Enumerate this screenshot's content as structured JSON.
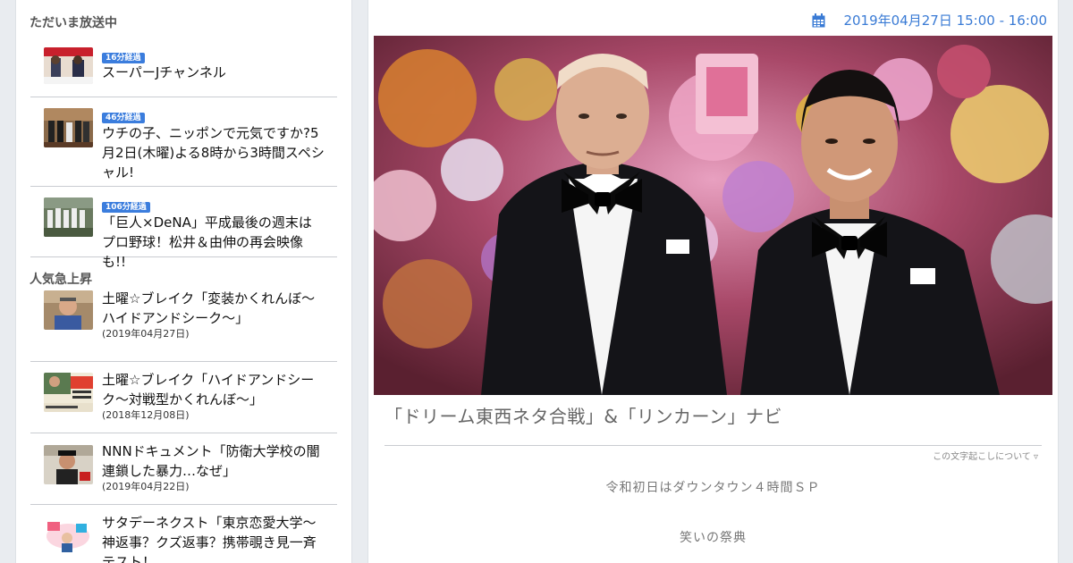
{
  "sidebar": {
    "on_air_title": "ただいま放送中",
    "on_air": [
      {
        "badge": "16分経過",
        "title": "スーパーJチャンネル"
      },
      {
        "badge": "46分経過",
        "title": "ウチの子、ニッポンで元気ですか?5月2日(木曜)よる8時から3時間スペシャル!"
      },
      {
        "badge": "106分経過",
        "title": "「巨人×DeNA」平成最後の週末はプロ野球！松井＆由伸の再会映像も!!"
      }
    ],
    "trending_title": "人気急上昇",
    "trending": [
      {
        "title": "土曜☆ブレイク「変装かくれんぼ～ハイドアンドシーク～」",
        "date": "(2019年04月27日)"
      },
      {
        "title": "土曜☆ブレイク「ハイドアンドシーク～対戦型かくれんぼ～」",
        "date": "(2018年12月08日)"
      },
      {
        "title": "NNNドキュメント「防衛大学校の闇 連鎖した暴力…なぜ」",
        "date": "(2019年04月22日)"
      },
      {
        "title": "サタデーネクスト「東京恋愛大学～神返事？クズ返事？携帯覗き見一斉テスト！",
        "date": ""
      }
    ]
  },
  "main": {
    "calendar_icon": "calendar-icon",
    "air_time": "2019年04月27日 15:00 - 16:00",
    "program_title": "「ドリーム東西ネタ合戦」&「リンカーン」ナビ",
    "transcript_link": "この文字起こしについて ▿",
    "paragraphs": [
      "令和初日はダウンタウン４時間ＳＰ",
      "笑いの祭典"
    ]
  },
  "colors": {
    "accent": "#3a7bd5",
    "badge": "#3b7ddd",
    "divider": "#c9ccd1"
  }
}
